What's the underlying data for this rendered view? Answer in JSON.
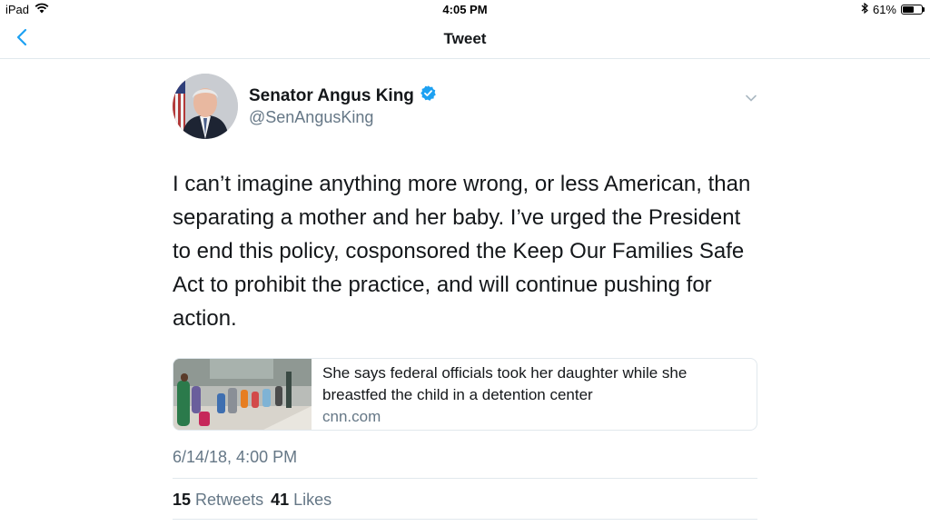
{
  "status_bar": {
    "device": "iPad",
    "time": "4:05 PM",
    "battery_text": "61%",
    "battery_level": 0.61,
    "icons": [
      "wifi-icon",
      "bluetooth-icon",
      "battery-icon"
    ]
  },
  "nav": {
    "title": "Tweet",
    "back_icon": "chevron-left-icon"
  },
  "tweet": {
    "display_name": "Senator Angus King",
    "verified": true,
    "handle": "@SenAngusKing",
    "text": "I can’t imagine anything more wrong, or less American, than separating a mother and her baby. I’ve urged the President to end this policy, cosponsored the Keep Our Families Safe Act to prohibit the practice, and will continue pushing for action.",
    "card": {
      "title": "She says federal officials took her daughter while she breastfed the child in a detention center",
      "domain": "cnn.com"
    },
    "timestamp": "6/14/18, 4:00 PM",
    "retweets_count": "15",
    "retweets_label": "Retweets",
    "likes_count": "41",
    "likes_label": "Likes"
  },
  "colors": {
    "accent": "#1da1f2",
    "secondary_text": "#657786",
    "divider": "#e1e8ed"
  }
}
